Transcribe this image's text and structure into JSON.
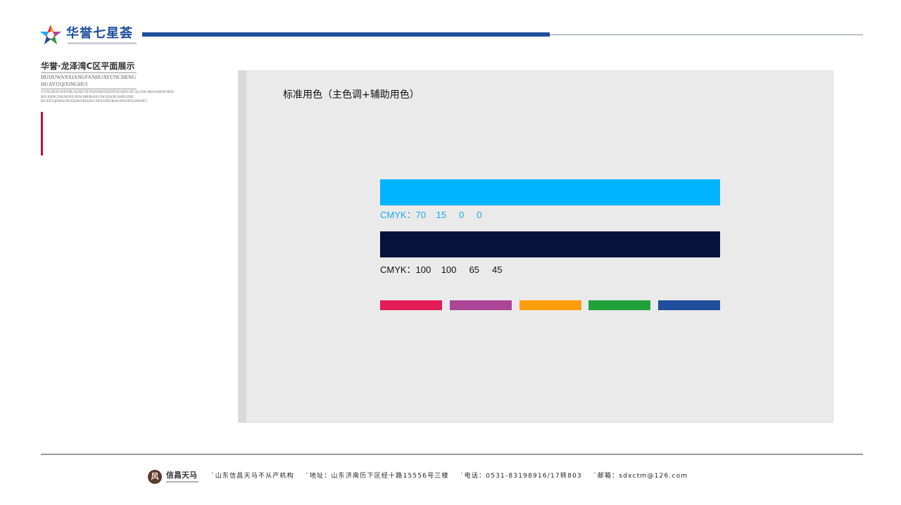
{
  "header": {
    "brand_name": "华誉七星荟",
    "colors": {
      "brand_blue": "#1f4e9c",
      "rule_gray": "#8a8f99"
    }
  },
  "sidebar": {
    "project_title": "华誉·龙泽湾C区平面展示",
    "pinyin_line_1": "HUIJUWANXIANGFANHUAYUNCHENG",
    "pinyin_line_2": "HUAYUQIXINGHUI",
    "small_line_1": "YUNCHENGWENHUAZHUTITIYANSHITESEFENGQINGJIE  QUANCHENGRENCHOU",
    "small_line_2": "RELIQINGZHUHONGXINGMEIKAILONGQIANGSHIIUZHU",
    "small_line_3": "HUAYUQIXINGHUIZHAOSHANGCHIXUHUOBAOJINXINGZHONG!",
    "accent_color": "#c0103b"
  },
  "panel": {
    "title": "标准用色（主色调+辅助用色）",
    "main_colors": [
      {
        "color": "#00b4ff",
        "cmyk_label": "CMYK：70    15     0     0",
        "label_color": "#1aa8e8"
      },
      {
        "color": "#07123a",
        "cmyk_label": "CMYK：100    100     65     45",
        "label_color": "#111111"
      }
    ],
    "aux_colors": [
      "#e31c58",
      "#ad4696",
      "#ff9e0c",
      "#22a03a",
      "#1f4e9c"
    ]
  },
  "footer": {
    "logo_icon": "风",
    "logo_name": "信昌天马",
    "info": "`山东信昌天马不从产机构    `地址：山东济南历下区经十路15556号三楼    `电话：0531-83198916/17转803    `邮箱：sdxctm@126.com"
  }
}
